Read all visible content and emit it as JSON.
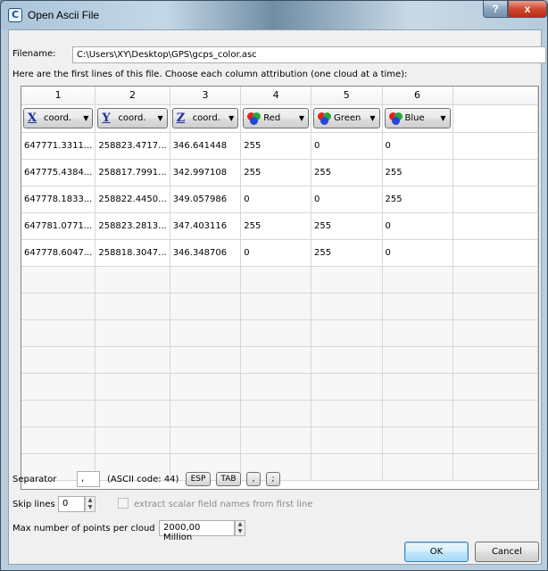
{
  "window": {
    "title": "Open Ascii File",
    "app_icon": "cc-logo-icon",
    "help_label": "?",
    "close_label": "x"
  },
  "filename": {
    "label": "Filename:",
    "value": "C:\\Users\\XY\\Desktop\\GPS\\gcps_color.asc"
  },
  "instructions": "Here are the first lines of this file. Choose each column attribution (one cloud at a time):",
  "table": {
    "column_headers": [
      "1",
      "2",
      "3",
      "4",
      "5",
      "6"
    ],
    "attributions": [
      {
        "icon": "x-axis-icon",
        "glyph": "X",
        "label": "coord."
      },
      {
        "icon": "y-axis-icon",
        "glyph": "Y",
        "label": "coord."
      },
      {
        "icon": "z-axis-icon",
        "glyph": "Z",
        "label": "coord."
      },
      {
        "icon": "rgb-color-icon",
        "label": "Red"
      },
      {
        "icon": "rgb-color-icon",
        "label": "Green"
      },
      {
        "icon": "rgb-color-icon",
        "label": "Blue"
      }
    ],
    "rows": [
      [
        "647771.3311...",
        "258823.4717...",
        "346.641448",
        "255",
        "0",
        "0"
      ],
      [
        "647775.4384...",
        "258817.7991...",
        "342.997108",
        "255",
        "255",
        "255"
      ],
      [
        "647778.1833...",
        "258822.4450...",
        "349.057986",
        "0",
        "0",
        "255"
      ],
      [
        "647781.0771...",
        "258823.2813...",
        "347.403116",
        "255",
        "255",
        "0"
      ],
      [
        "647778.6047...",
        "258818.3047...",
        "346.348706",
        "0",
        "255",
        "0"
      ]
    ],
    "empty_rows": 8
  },
  "separator": {
    "label": "Separator",
    "value": ",",
    "ascii_code": "(ASCII code: 44)",
    "buttons": [
      "ESP",
      "TAB",
      ",",
      ";"
    ]
  },
  "skip_lines": {
    "label": "Skip lines",
    "value": "0",
    "checkbox_label": "extract scalar field names from first line",
    "checkbox_checked": false
  },
  "max_points": {
    "label": "Max number of points per cloud",
    "value": "2000,00 Million"
  },
  "buttons": {
    "ok": "OK",
    "cancel": "Cancel"
  },
  "colors": {
    "axis_icon": "#1b2f9e",
    "ok_border": "#3c7fb1",
    "close_button": "#cf4a2f"
  }
}
